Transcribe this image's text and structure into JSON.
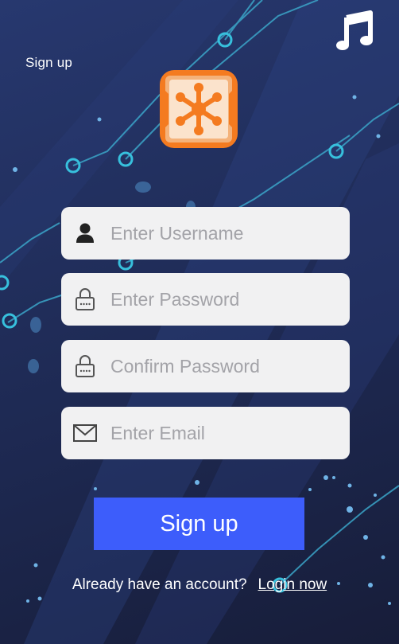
{
  "window": {
    "title": "Sign up"
  },
  "icons": {
    "music": "music-note-icon",
    "logo": "network-hub-logo"
  },
  "form": {
    "username": {
      "placeholder": "Enter Username",
      "value": "",
      "icon": "user-icon"
    },
    "password": {
      "placeholder": "Enter Password",
      "value": "",
      "icon": "lock-icon"
    },
    "confirm_password": {
      "placeholder": "Confirm Password",
      "value": "",
      "icon": "lock-icon"
    },
    "email": {
      "placeholder": "Enter Email",
      "value": "",
      "icon": "envelope-icon"
    },
    "submit_label": "Sign up"
  },
  "footer": {
    "prompt": "Already have an account?",
    "link_label": "Login now"
  },
  "colors": {
    "accent": "#3d5dfb",
    "logo_orange": "#f47b20",
    "background": "#22305f",
    "field_bg": "#f1f1f2"
  }
}
